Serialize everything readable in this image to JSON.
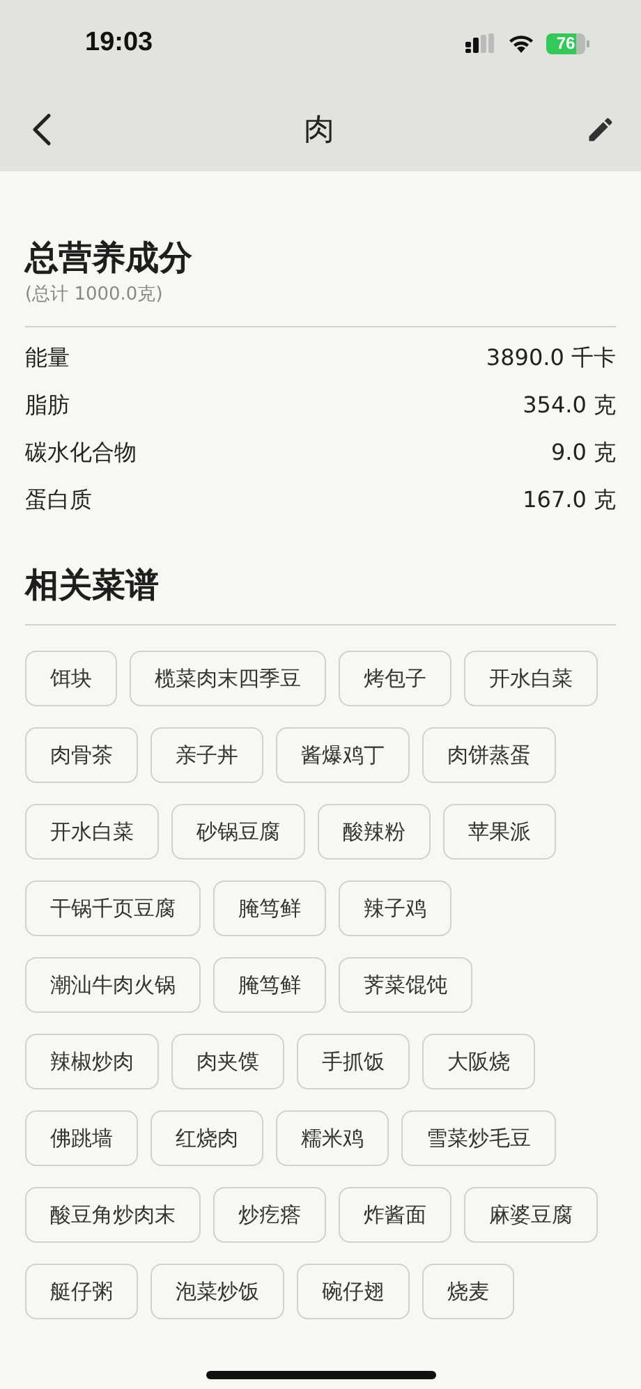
{
  "status_bar": {
    "time": "19:03",
    "battery": "76"
  },
  "nav_bar": {
    "title": "肉"
  },
  "total_nutrition": {
    "title": "总营养成分",
    "subtitle": "(总计 1000.0克)",
    "rows": [
      {
        "label": "能量",
        "value": "3890.0 千卡"
      },
      {
        "label": "脂肪",
        "value": "354.0 克"
      },
      {
        "label": "碳水化合物",
        "value": "9.0 克"
      },
      {
        "label": "蛋白质",
        "value": "167.0 克"
      }
    ]
  },
  "related_recipes": {
    "title": "相关菜谱",
    "chips": [
      "饵块",
      "榄菜肉末四季豆",
      "烤包子",
      "开水白菜",
      "肉骨茶",
      "亲子丼",
      "酱爆鸡丁",
      "肉饼蒸蛋",
      "开水白菜",
      "砂锅豆腐",
      "酸辣粉",
      "苹果派",
      "干锅千页豆腐",
      "腌笃鲜",
      "辣子鸡",
      "潮汕牛肉火锅",
      "腌笃鲜",
      "荠菜馄饨",
      "辣椒炒肉",
      "肉夹馍",
      "手抓饭",
      "大阪烧",
      "佛跳墙",
      "红烧肉",
      "糯米鸡",
      "雪菜炒毛豆",
      "酸豆角炒肉末",
      "炒疙瘩",
      "炸酱面",
      "麻婆豆腐",
      "艇仔粥",
      "泡菜炒饭",
      "碗仔翅",
      "烧麦"
    ]
  }
}
